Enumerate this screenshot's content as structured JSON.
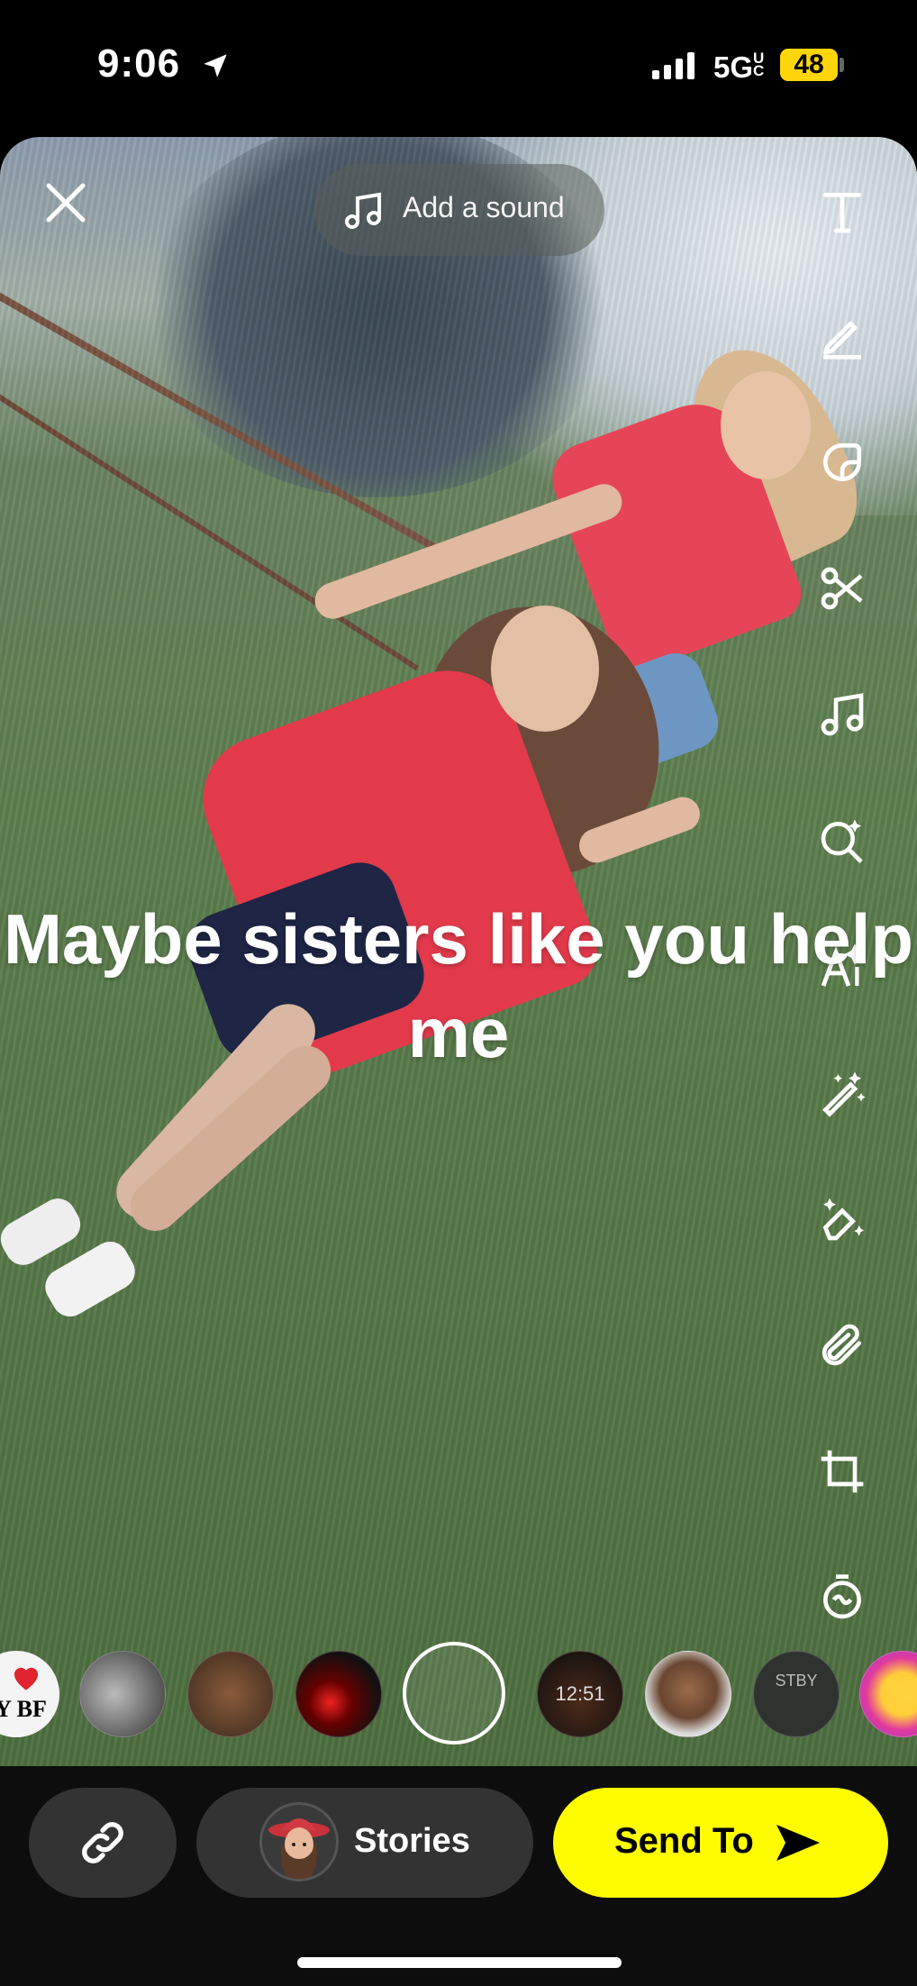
{
  "status_bar": {
    "time": "9:06",
    "network": "5G",
    "network_suffix": "UC",
    "battery": "48",
    "battery_color": "#ffd60a"
  },
  "editor": {
    "add_sound_label": "Add a sound",
    "caption": "Maybe sisters like you help me",
    "tools": [
      "text-icon",
      "pencil-icon",
      "sticker-icon",
      "scissors-icon",
      "music-note-icon",
      "lens-search-icon",
      "ai-text-icon",
      "magic-wand-icon",
      "eraser-sparkle-icon",
      "paperclip-icon",
      "crop-icon",
      "timer-icon"
    ]
  },
  "lens_carousel": {
    "items": [
      {
        "name": "lens-my-bf",
        "text": "IY BF"
      },
      {
        "name": "lens-bw-face",
        "text": ""
      },
      {
        "name": "lens-vintage",
        "text": ""
      },
      {
        "name": "lens-lashes",
        "text": ""
      },
      {
        "name": "lens-selected",
        "text": ""
      },
      {
        "name": "lens-clock",
        "text": "12:51"
      },
      {
        "name": "lens-bitmoji-crying",
        "text": ""
      },
      {
        "name": "lens-stby",
        "text": "STBY"
      },
      {
        "name": "lens-emoji-halo",
        "text": ""
      }
    ]
  },
  "bottom_bar": {
    "stories_label": "Stories",
    "send_label": "Send To",
    "accent": "#fffc00"
  }
}
